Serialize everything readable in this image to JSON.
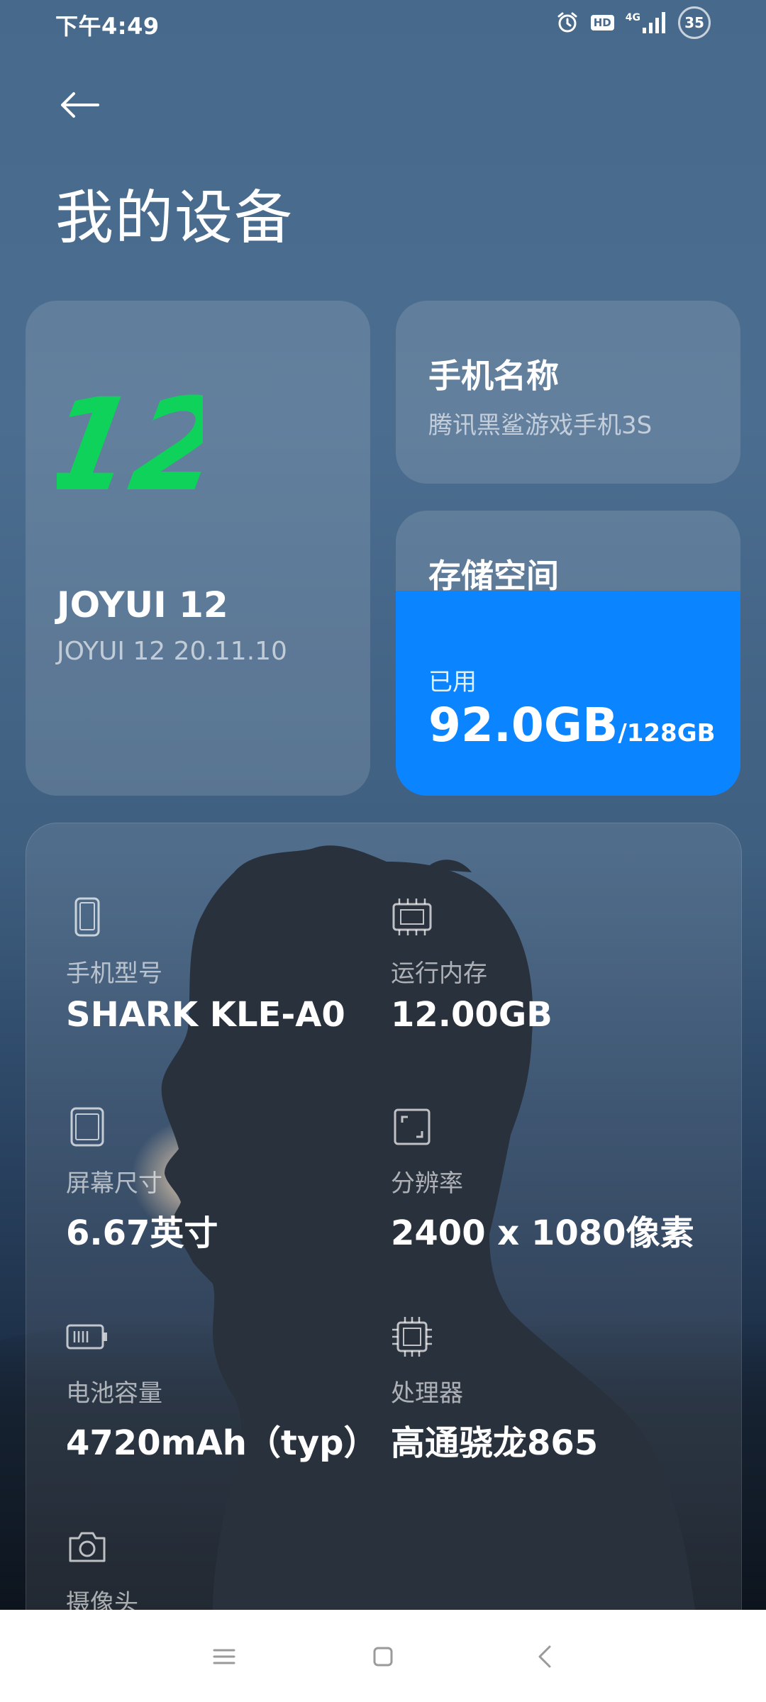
{
  "status_bar": {
    "time": "下午4:49",
    "hd_label": "HD",
    "network_label": "4G",
    "battery_level": "35"
  },
  "header": {
    "title": "我的设备"
  },
  "os_card": {
    "logo_text": "12",
    "logo_color": "#0ed25a",
    "name": "JOYUI 12",
    "version": "JOYUI 12 20.11.10"
  },
  "phone_name_card": {
    "label": "手机名称",
    "value": "腾讯黑鲨游戏手机3S"
  },
  "storage_card": {
    "label": "存储空间",
    "used_label": "已用",
    "used": "92.0GB",
    "total": "/128GB",
    "used_fraction": 0.72,
    "fill_color": "#0a84ff"
  },
  "specs": [
    {
      "icon": "phone-icon",
      "label": "手机型号",
      "value": "SHARK KLE-A0"
    },
    {
      "icon": "memory-chip-icon",
      "label": "运行内存",
      "value": "12.00GB"
    },
    {
      "icon": "screen-icon",
      "label": "屏幕尺寸",
      "value": "6.67英寸"
    },
    {
      "icon": "resolution-icon",
      "label": "分辨率",
      "value": "2400 x 1080像素"
    },
    {
      "icon": "battery-icon",
      "label": "电池容量",
      "value": "4720mAh（typ）"
    },
    {
      "icon": "processor-icon",
      "label": "处理器",
      "value": "高通骁龙865"
    },
    {
      "icon": "camera-icon",
      "label": "摄像头",
      "value": ""
    }
  ],
  "nav_bar": {
    "menu": "menu-icon",
    "home": "home-icon",
    "back": "back-icon"
  }
}
